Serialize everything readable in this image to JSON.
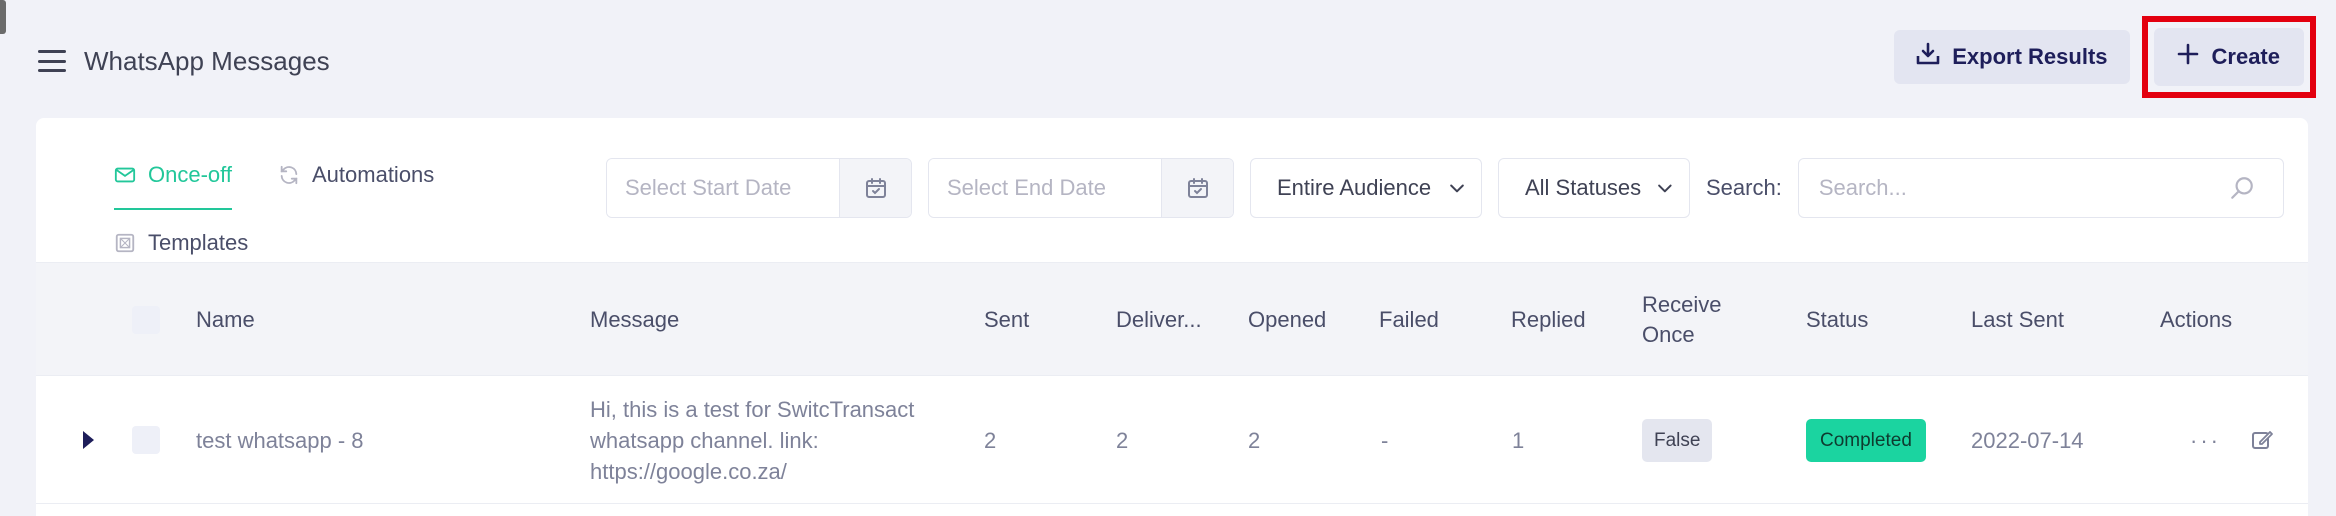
{
  "header": {
    "title": "WhatsApp Messages",
    "export_label": "Export Results",
    "create_label": "Create"
  },
  "tabs": {
    "once_off": "Once-off",
    "automations": "Automations",
    "templates": "Templates"
  },
  "filters": {
    "start_date_placeholder": "Select Start Date",
    "end_date_placeholder": "Select End Date",
    "audience_value": "Entire Audience",
    "status_value": "All Statuses",
    "search_label": "Search:",
    "search_placeholder": "Search..."
  },
  "table": {
    "columns": {
      "name": "Name",
      "message": "Message",
      "sent": "Sent",
      "delivered": "Deliver...",
      "opened": "Opened",
      "failed": "Failed",
      "replied": "Replied",
      "receive_once_1": "Receive",
      "receive_once_2": "Once",
      "status": "Status",
      "last_sent": "Last Sent",
      "actions": "Actions"
    },
    "rows": [
      {
        "name": "test whatsapp - 8",
        "message_line1": "Hi, this is a test for SwitcTransact",
        "message_line2": "whatsapp channel. link:",
        "message_line3": "https://google.co.za/",
        "sent": "2",
        "delivered": "2",
        "opened": "2",
        "failed": "-",
        "replied": "1",
        "receive_once": "False",
        "status": "Completed",
        "last_sent": "2022-07-14",
        "actions_more": "···"
      }
    ]
  },
  "colors": {
    "accent": "#22c79a",
    "status_completed": "#1bd4a0",
    "highlight_border": "#e3000f",
    "button_bg": "#e3e5f1"
  },
  "icons": {
    "menu": "hamburger-icon",
    "export": "download-icon",
    "create": "plus-icon",
    "once_off": "envelope-icon",
    "automations": "refresh-icon",
    "templates": "template-icon",
    "calendar": "calendar-icon",
    "chevron": "chevron-down-icon",
    "search": "search-icon",
    "expand": "caret-right-icon",
    "more": "more-dots-icon",
    "edit": "edit-icon"
  }
}
